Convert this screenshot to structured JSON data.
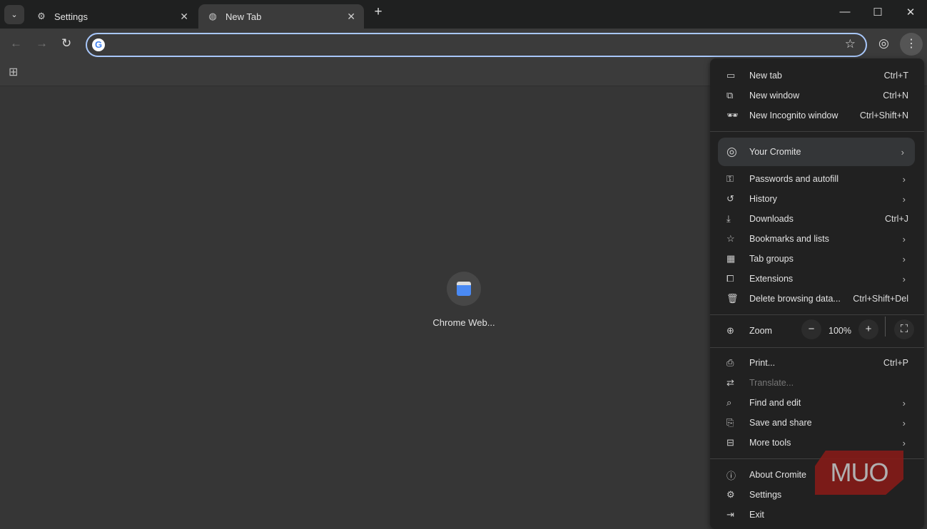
{
  "tabs": [
    {
      "label": "Settings",
      "icon": "gear-icon"
    },
    {
      "label": "New Tab",
      "icon": "globe-icon"
    }
  ],
  "omnibox": {
    "value": "",
    "placeholder": ""
  },
  "shortcut_tile": {
    "label": "Chrome Web..."
  },
  "menu": {
    "group1": [
      {
        "label": "New tab",
        "shortcut": "Ctrl+T",
        "icon": "▭"
      },
      {
        "label": "New window",
        "shortcut": "Ctrl+N",
        "icon": "⧉"
      },
      {
        "label": "New Incognito window",
        "shortcut": "Ctrl+Shift+N",
        "icon": "🕶"
      }
    ],
    "profile": {
      "label": "Your Cromite"
    },
    "group2": [
      {
        "label": "Passwords and autofill",
        "submenu": true,
        "icon": "⚿"
      },
      {
        "label": "History",
        "submenu": true,
        "icon": "↺"
      },
      {
        "label": "Downloads",
        "shortcut": "Ctrl+J",
        "icon": "⤓"
      },
      {
        "label": "Bookmarks and lists",
        "submenu": true,
        "icon": "☆"
      },
      {
        "label": "Tab groups",
        "submenu": true,
        "icon": "▦"
      },
      {
        "label": "Extensions",
        "submenu": true,
        "icon": "⧠"
      },
      {
        "label": "Delete browsing data...",
        "shortcut": "Ctrl+Shift+Del",
        "icon": "🗑"
      }
    ],
    "zoom": {
      "label": "Zoom",
      "value": "100%"
    },
    "group3": [
      {
        "label": "Print...",
        "shortcut": "Ctrl+P",
        "icon": "⎙"
      },
      {
        "label": "Translate...",
        "disabled": true,
        "icon": "⇄"
      },
      {
        "label": "Find and edit",
        "submenu": true,
        "icon": "⌕"
      },
      {
        "label": "Save and share",
        "submenu": true,
        "icon": "⎘"
      },
      {
        "label": "More tools",
        "submenu": true,
        "icon": "⊟"
      }
    ],
    "group4": [
      {
        "label": "About Cromite",
        "icon": "ⓘ"
      },
      {
        "label": "Settings",
        "icon": "⚙"
      },
      {
        "label": "Exit",
        "icon": "⇥"
      }
    ]
  },
  "watermark": "MUO"
}
